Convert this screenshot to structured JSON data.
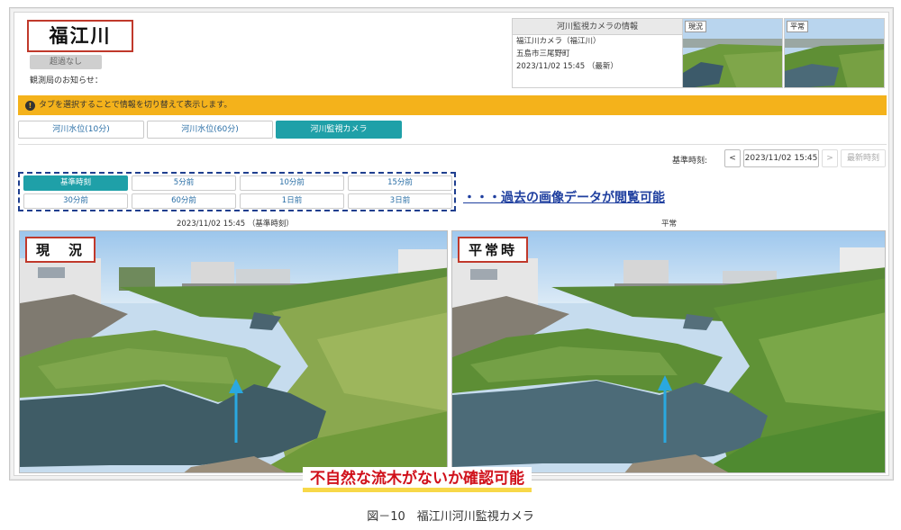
{
  "header": {
    "river_name": "福江川",
    "level_badge": "超過なし",
    "notice_label": "観測局のお知らせ："
  },
  "camera_info": {
    "title": "河川監視カメラの情報",
    "camera_name": "福江川カメラ（福江川）",
    "location": "五島市三尾野町",
    "datetime": "2023/11/02 15:45 （最新）"
  },
  "thumbnails": [
    {
      "label": "現況"
    },
    {
      "label": "平常"
    }
  ],
  "info_bar": {
    "icon": "info-icon",
    "text": "タブを選択することで情報を切り替えて表示します。"
  },
  "tabs": [
    {
      "label": "河川水位(10分)",
      "active": false
    },
    {
      "label": "河川水位(60分)",
      "active": false
    },
    {
      "label": "河川監視カメラ",
      "active": true
    }
  ],
  "base_time": {
    "label": "基準時刻:",
    "prev": "<",
    "value": "2023/11/02 15:45",
    "next": ">",
    "latest": "最新時刻"
  },
  "time_buttons": [
    {
      "label": "基準時刻",
      "active": true
    },
    {
      "label": "5分前"
    },
    {
      "label": "10分前"
    },
    {
      "label": "15分前"
    },
    {
      "label": "30分前"
    },
    {
      "label": "60分前"
    },
    {
      "label": "1日前"
    },
    {
      "label": "3日前"
    }
  ],
  "annotation_past": "・・・過去の画像データが閲覧可能",
  "images": {
    "current_caption": "2023/11/02 15:45 （基準時刻）",
    "normal_caption": "平常",
    "current_label": "現　況",
    "normal_label": "平常時"
  },
  "annotation_check": "不自然な流木がないか確認可能",
  "figure_caption": "図－10　福江川河川監視カメラ",
  "colors": {
    "accent_teal": "#1fa0a8",
    "info_bar": "#f4b21b",
    "highlight_red": "#c0392b",
    "annotation_blue": "#1f3f9f",
    "arrow_blue": "#2aa8e0"
  }
}
